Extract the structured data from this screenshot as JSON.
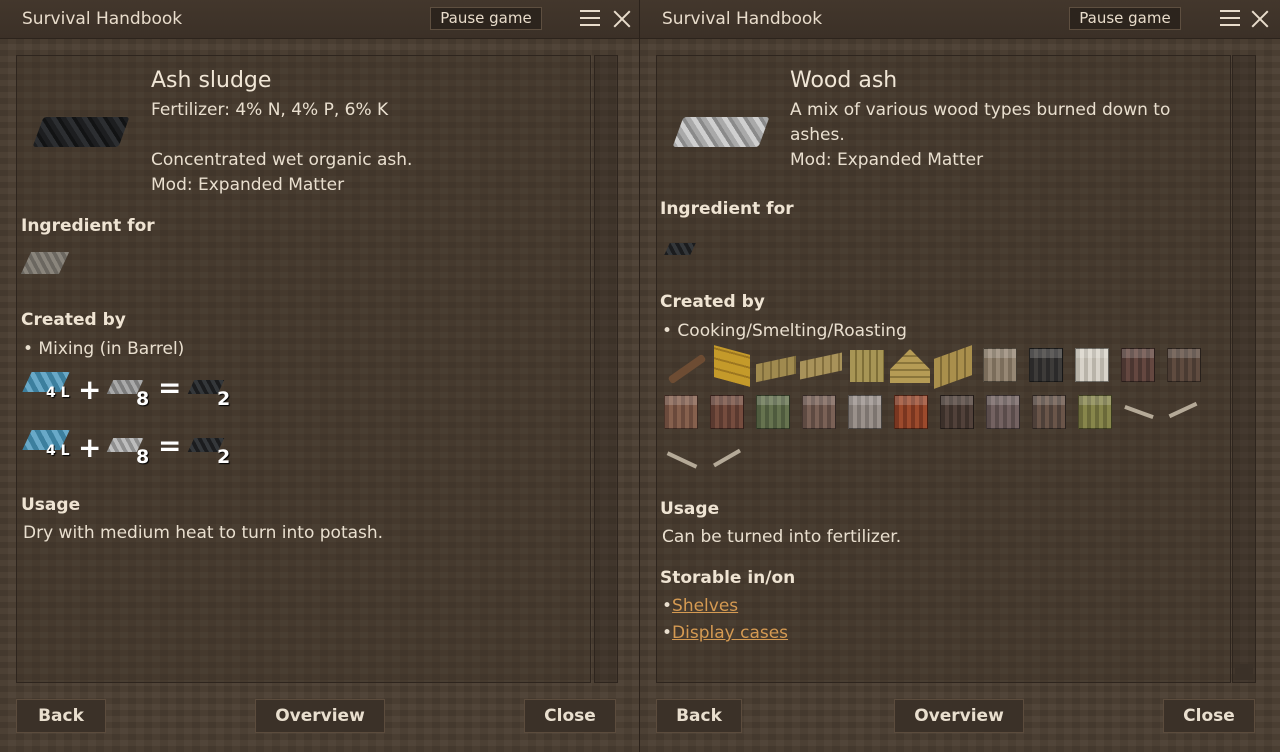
{
  "left": {
    "title": "Survival Handbook",
    "pause_label": "Pause game",
    "item_name": "Ash sludge",
    "desc_lines": [
      "Fertilizer: 4% N, 4% P, 6% K",
      "Concentrated wet organic ash.",
      "Mod: Expanded Matter"
    ],
    "ingredient_heading": "Ingredient for",
    "created_heading": "Created by",
    "created_method": "• Mixing (in Barrel)",
    "recipes": [
      {
        "in1_qty": "4 L",
        "in2_qty": "8",
        "out_qty": "2"
      },
      {
        "in1_qty": "4 L",
        "in2_qty": "8",
        "out_qty": "2"
      }
    ],
    "plus": "+",
    "equals": "=",
    "usage_heading": "Usage",
    "usage_text": "Dry with medium heat to turn into potash.",
    "buttons": {
      "back": "Back",
      "overview": "Overview",
      "close": "Close"
    }
  },
  "right": {
    "title": "Survival Handbook",
    "pause_label": "Pause game",
    "item_name": "Wood ash",
    "desc_lines": [
      "A mix of various wood types burned down to",
      "ashes.",
      "Mod: Expanded Matter"
    ],
    "ingredient_heading": "Ingredient for",
    "created_heading": "Created by",
    "created_method": "• Cooking/Smelting/Roasting",
    "usage_heading": "Usage",
    "usage_text": "Can be turned into fertilizer.",
    "storable_heading": "Storable in/on",
    "storable": [
      "Shelves",
      "Display cases"
    ],
    "bullet": "•",
    "buttons": {
      "back": "Back",
      "overview": "Overview",
      "close": "Close"
    }
  },
  "icons": {
    "menu": "hamburger-menu-icon",
    "close": "close-x-icon"
  },
  "colors": {
    "link": "#d59a52",
    "panel_bg": "#4b3e32"
  }
}
